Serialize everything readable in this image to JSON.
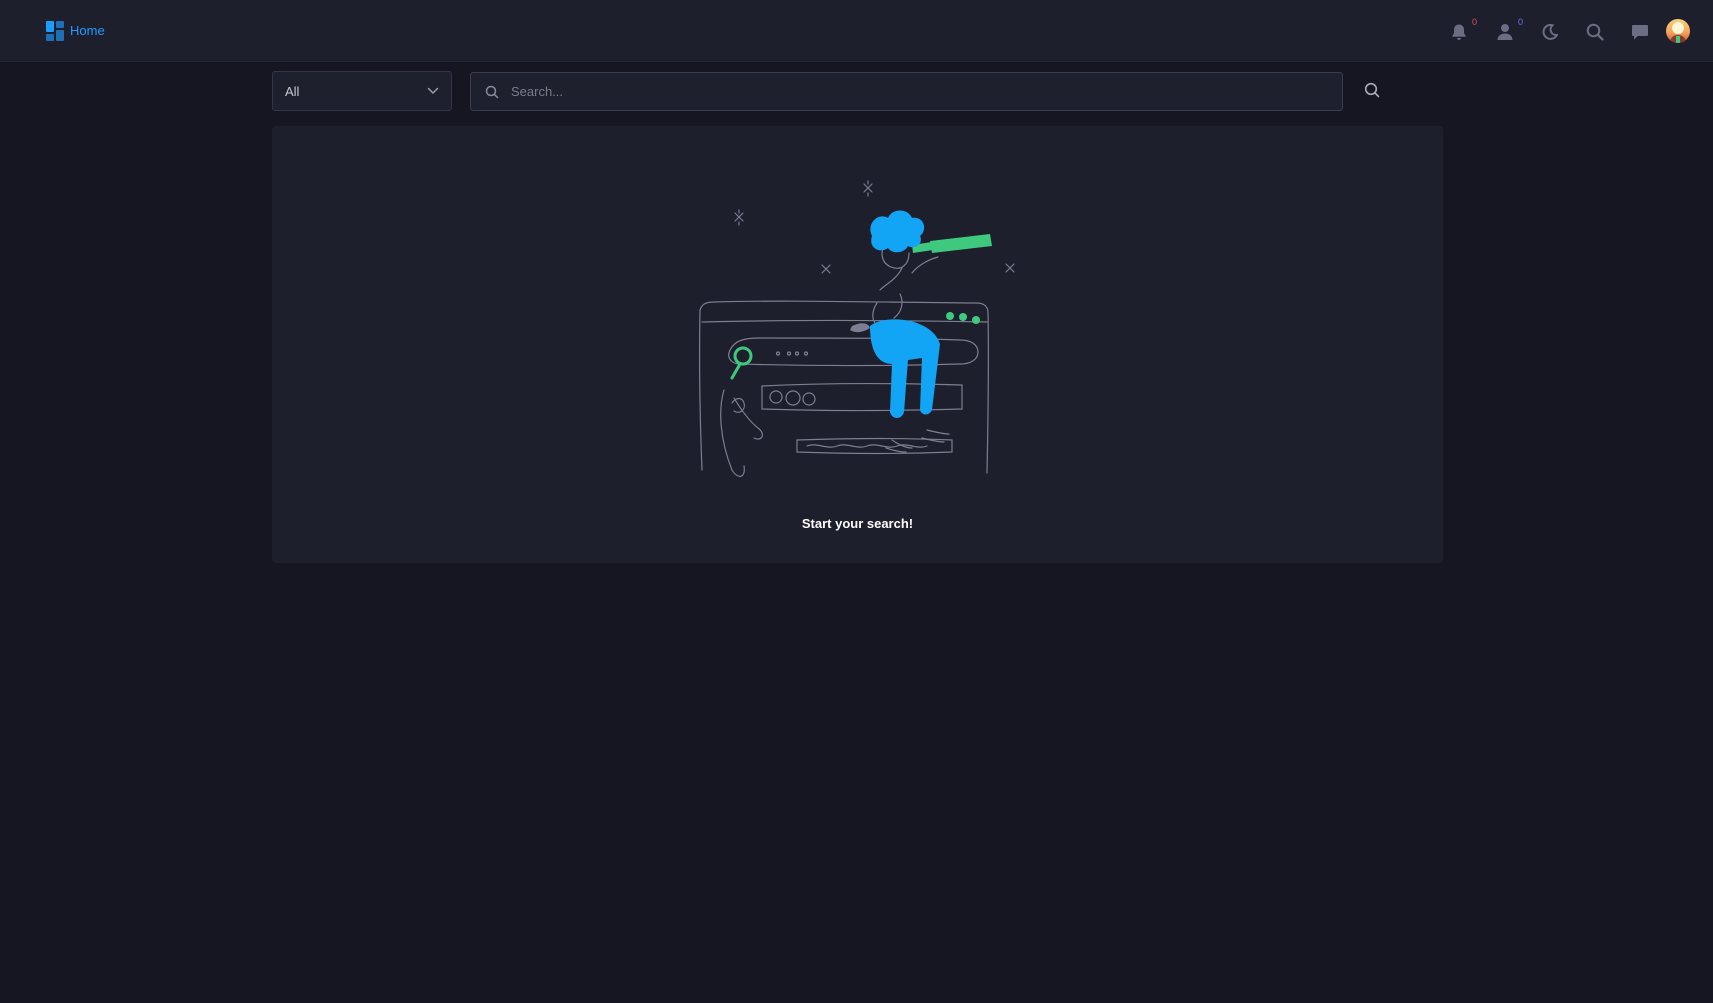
{
  "header": {
    "brand_label": "Home",
    "notifications_count": "0",
    "friend_requests_count": "0",
    "icons": [
      "grid-logo-icon",
      "bell-icon",
      "user-icon",
      "moon-icon",
      "search-icon",
      "chat-icon",
      "avatar"
    ],
    "colors": {
      "accent": "#1e9bff",
      "badge_red": "#e5485c",
      "badge_blue": "#6676f1",
      "icon_muted": "#6b6d85"
    }
  },
  "search": {
    "filter_value": "All",
    "placeholder": "Search...",
    "query": ""
  },
  "results": {
    "empty_message": "Start your search!",
    "colors": {
      "highlight_blue": "#12a4f5",
      "highlight_green": "#3ec97f"
    }
  }
}
